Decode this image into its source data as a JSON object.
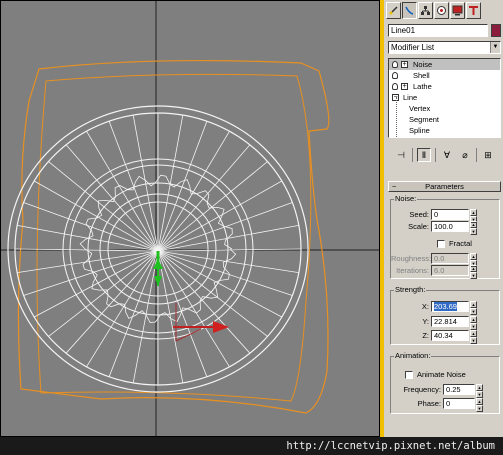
{
  "watermark": "http://lccnetvip.pixnet.net/album",
  "panel": {
    "tabs": [
      {
        "name": "create-tab-icon"
      },
      {
        "name": "modify-tab-icon"
      },
      {
        "name": "hierarchy-tab-icon"
      },
      {
        "name": "motion-tab-icon"
      },
      {
        "name": "display-tab-icon"
      },
      {
        "name": "utilities-tab-icon"
      }
    ],
    "object_name": "Line01",
    "object_color": "#8c1c3c",
    "modifier_list": "Modifier List",
    "stack": {
      "noise": "Noise",
      "shell": "Shell",
      "lathe": "Lathe",
      "line": "Line",
      "vertex": "Vertex",
      "segment": "Segment",
      "spline": "Spline"
    },
    "rollout_title": "Parameters",
    "noise_group": {
      "label": "Noise:",
      "seed_label": "Seed:",
      "seed": "0",
      "scale_label": "Scale:",
      "scale": "100.0",
      "fractal_label": "Fractal",
      "roughness_label": "Roughness:",
      "roughness": "0.0",
      "iterations_label": "Iterations:",
      "iterations": "6.0"
    },
    "strength_group": {
      "label": "Strength:",
      "x_label": "X:",
      "x": "203.69",
      "y_label": "Y:",
      "y": "22.814",
      "z_label": "Z:",
      "z": "40.34"
    },
    "animation_group": {
      "label": "Animation:",
      "animate_label": "Animate Noise",
      "frequency_label": "Frequency:",
      "frequency": "0.25",
      "phase_label": "Phase:",
      "phase": "0"
    }
  }
}
